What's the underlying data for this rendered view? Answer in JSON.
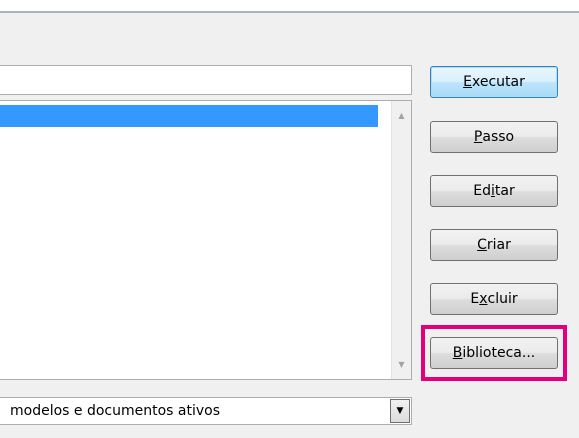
{
  "macro_name_input": {
    "value": ""
  },
  "buttons": {
    "run": {
      "prefix": "",
      "mnemonic": "E",
      "suffix": "xecutar"
    },
    "step": {
      "prefix": "",
      "mnemonic": "P",
      "suffix": "asso"
    },
    "edit": {
      "prefix": "Ed",
      "mnemonic": "i",
      "suffix": "tar"
    },
    "create": {
      "prefix": "",
      "mnemonic": "C",
      "suffix": "riar"
    },
    "delete": {
      "prefix": "E",
      "mnemonic": "x",
      "suffix": "cluir"
    },
    "library": {
      "prefix": "",
      "mnemonic": "B",
      "suffix": "iblioteca..."
    }
  },
  "macros_in": {
    "selected_value": "modelos e documentos ativos"
  },
  "icons": {
    "scroll_up": "▲",
    "scroll_down": "▼",
    "dropdown": "▼"
  },
  "colors": {
    "highlight": "#e3007a",
    "selection": "#3399ff"
  }
}
